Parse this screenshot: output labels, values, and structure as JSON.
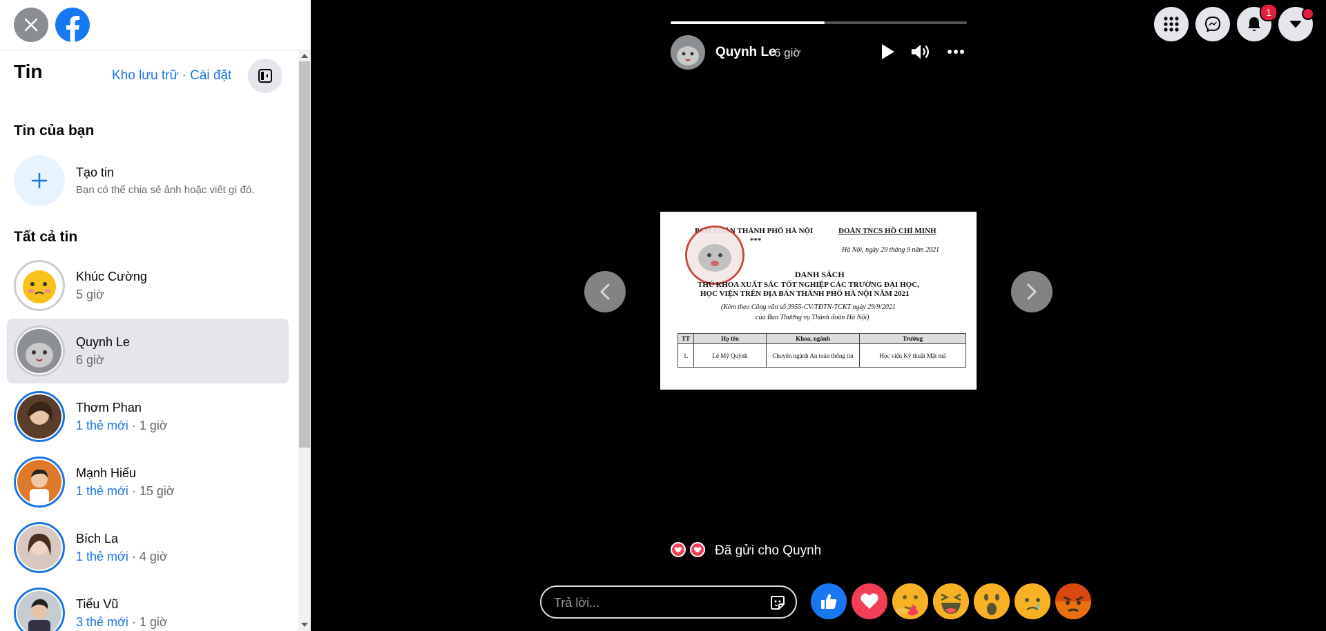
{
  "sidebar": {
    "title": "Tin",
    "links": {
      "archive": "Kho lưu trữ",
      "separator": " · ",
      "settings": "Cài đặt"
    },
    "your_story": {
      "heading": "Tin của bạn",
      "create_title": "Tạo tin",
      "create_sub": "Bạn có thể chia sẻ ảnh hoặc viết gì đó."
    },
    "all_stories_heading": "Tất cả tin",
    "stories": [
      {
        "name": "Khúc Cường",
        "new": "",
        "time": "5 giờ",
        "seen": true,
        "active": false
      },
      {
        "name": "Quynh Le",
        "new": "",
        "time": "6 giờ",
        "seen": true,
        "active": true
      },
      {
        "name": "Thơm Phan",
        "new": "1 thẻ mới",
        "time": " · 1 giờ",
        "seen": false,
        "active": false
      },
      {
        "name": "Mạnh Hiếu",
        "new": "1 thẻ mới",
        "time": " · 15 giờ",
        "seen": false,
        "active": false
      },
      {
        "name": "Bích La",
        "new": "1 thẻ mới",
        "time": " · 4 giờ",
        "seen": false,
        "active": false
      },
      {
        "name": "Tiểu Vũ",
        "new": "3 thẻ mới",
        "time": " · 1 giờ",
        "seen": false,
        "active": false
      }
    ]
  },
  "viewer": {
    "progress": 0.52,
    "author": "Quynh Le",
    "time": "6 giờ",
    "document": {
      "left_header": "BCH ĐOÀN THÀNH PHỐ HÀ NỘI",
      "left_stars": "***",
      "right_header": "ĐOÀN TNCS HỒ CHÍ MINH",
      "date": "Hà Nội, ngày 29 tháng 9 năm 2021",
      "title": "DANH SÁCH",
      "subtitle1": "THỦ KHOA XUẤT SẮC TỐT NGHIỆP CÁC TRƯỜNG ĐẠI HỌC,",
      "subtitle2": "HỌC VIỆN TRÊN ĐỊA BÀN THÀNH PHỐ HÀ NỘI NĂM 2021",
      "note1": "(Kèm theo Công văn số 3955-CV/TĐTN-TCKT ngày 29/9/2021",
      "note2": "của Ban Thường vụ Thành đoàn Hà Nội)",
      "columns": [
        "TT",
        "Họ tên",
        "Khoa, ngành",
        "Trường"
      ],
      "row": [
        "1.",
        "Lê Mỹ Quỳnh",
        "Chuyên ngành An toàn thông tin",
        "Học viện Kỹ thuật Mật mã"
      ]
    },
    "sent_text": "Đã gửi cho Quynh",
    "reply_placeholder": "Trả lời..."
  },
  "topbar": {
    "notification_count": "1"
  },
  "colors": {
    "accent": "#1b74e4",
    "like": "#1877f2",
    "love": "#f33e58"
  },
  "icons": [
    "close-icon",
    "facebook-logo",
    "settings-icon",
    "plus-icon",
    "play-icon",
    "volume-icon",
    "more-icon",
    "chevron-left-icon",
    "chevron-right-icon",
    "sticker-icon",
    "menu-grid-icon",
    "messenger-icon",
    "bell-icon",
    "caret-down-icon"
  ]
}
